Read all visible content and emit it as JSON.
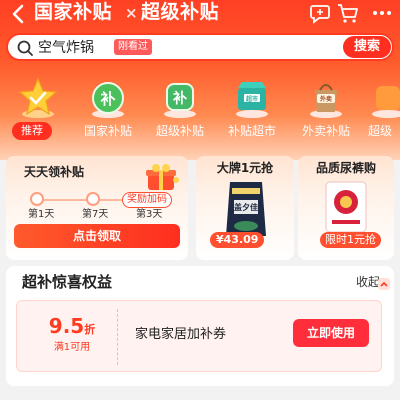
{
  "header": {
    "title_part1": "国家补贴",
    "title_separator": "×",
    "title_part2": "超级补贴",
    "back_icon": "back-arrow-icon",
    "right_icons": [
      "support-chat-icon",
      "cart-icon",
      "more-icon"
    ]
  },
  "search": {
    "query": "空气炸锅",
    "tag": "刚看过",
    "button": "搜索"
  },
  "categories": [
    {
      "label": "推荐",
      "icon": "thumbs-up-star-icon",
      "active": true
    },
    {
      "label": "国家补贴",
      "icon": "bu-badge-icon",
      "active": false
    },
    {
      "label": "超级补贴",
      "icon": "bu-badge-icon",
      "active": false
    },
    {
      "label": "补贴超市",
      "icon": "supermarket-icon",
      "active": false
    },
    {
      "label": "外卖补贴",
      "icon": "takeout-bag-icon",
      "active": false
    },
    {
      "label": "超级",
      "icon": "category-icon",
      "active": false
    }
  ],
  "daily_card": {
    "title": "天天领补贴",
    "days": [
      "第1天",
      "第7天",
      "第3天"
    ],
    "reward_tag": "奖励加码",
    "claim_button": "点击领取"
  },
  "brand_card": {
    "title": "大牌1元抢",
    "product_label": "盖夕佳",
    "price": "¥43.09"
  },
  "diaper_card": {
    "title": "品质尿裤购",
    "limit_tag": "限时1元抢"
  },
  "benefits": {
    "title": "超补惊喜权益",
    "collapse": "收起",
    "coupon": {
      "amount": "9.5",
      "unit": "折",
      "condition": "满1可用",
      "name": "家电家居加补券",
      "button": "立即使用"
    }
  },
  "colors": {
    "accent_red": "#ff2e1f",
    "hero_orange": "#ff5a2b",
    "card_peach": "#ffe4d2"
  }
}
